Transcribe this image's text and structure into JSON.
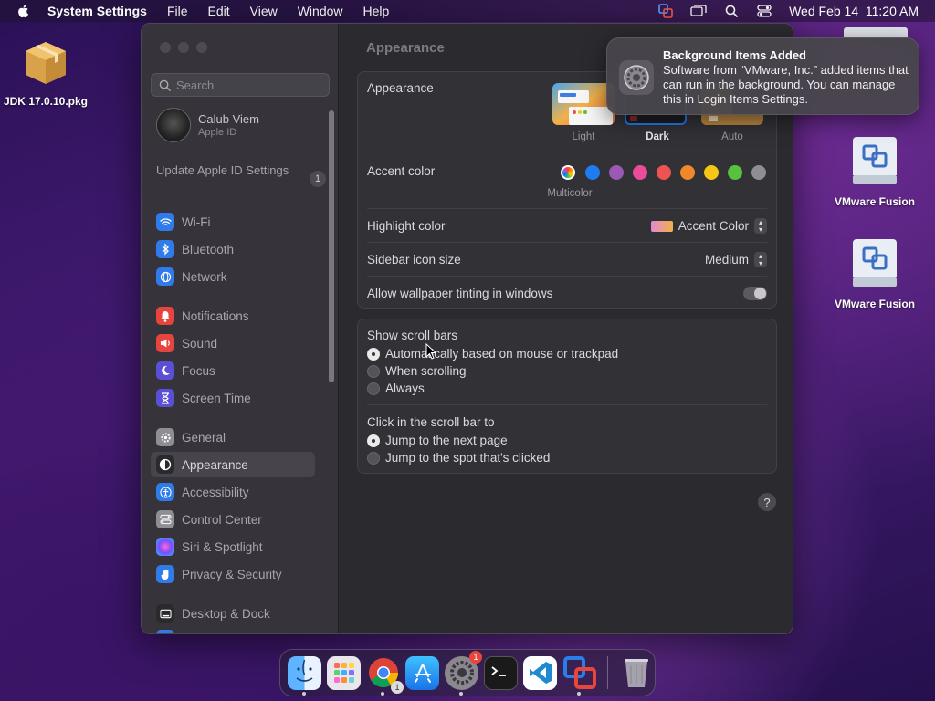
{
  "menubar": {
    "app_name": "System Settings",
    "menus": [
      "File",
      "Edit",
      "View",
      "Window",
      "Help"
    ],
    "datetime": "Wed Feb 14  11:20 AM"
  },
  "desktop": {
    "items": [
      {
        "label": "JDK 17.0.10.pkg",
        "icon": "package-icon"
      },
      {
        "label": "VMware Fusion",
        "icon": "disk-image-icon"
      },
      {
        "label": "VMware Fusion",
        "icon": "disk-image-icon"
      }
    ]
  },
  "sidebar": {
    "search_placeholder": "Search",
    "profile": {
      "name": "Calub Viem",
      "subtitle": "Apple ID"
    },
    "update": {
      "label": "Update Apple ID Settings",
      "badge": "1"
    },
    "items": [
      {
        "label": "Wi-Fi",
        "icon": "wifi-icon",
        "color": "#2f7bea"
      },
      {
        "label": "Bluetooth",
        "icon": "bluetooth-icon",
        "color": "#2f7bea"
      },
      {
        "label": "Network",
        "icon": "globe-icon",
        "color": "#2f7bea"
      },
      {
        "label": "Notifications",
        "icon": "bell-icon",
        "color": "#e6453d"
      },
      {
        "label": "Sound",
        "icon": "speaker-icon",
        "color": "#e6453d"
      },
      {
        "label": "Focus",
        "icon": "moon-icon",
        "color": "#5b4fd6"
      },
      {
        "label": "Screen Time",
        "icon": "hourglass-icon",
        "color": "#5b4fd6"
      },
      {
        "label": "General",
        "icon": "gear-icon",
        "color": "#8e8e93"
      },
      {
        "label": "Appearance",
        "icon": "appearance-icon",
        "color": "#3a3a3c"
      },
      {
        "label": "Accessibility",
        "icon": "accessibility-icon",
        "color": "#2f7bea"
      },
      {
        "label": "Control Center",
        "icon": "control-center-icon",
        "color": "#8e8e93"
      },
      {
        "label": "Siri & Spotlight",
        "icon": "siri-icon",
        "color": "#c34fd6"
      },
      {
        "label": "Privacy & Security",
        "icon": "hand-icon",
        "color": "#2f7bea"
      },
      {
        "label": "Desktop & Dock",
        "icon": "dock-icon",
        "color": "#3a3a3c"
      }
    ]
  },
  "main": {
    "title": "Appearance",
    "appearance": {
      "label": "Appearance",
      "options": [
        "Light",
        "Dark",
        "Auto"
      ],
      "selected": "Dark"
    },
    "accent": {
      "label": "Accent color",
      "caption": "Multicolor",
      "colors": [
        "#e04bbd",
        "#1f7cf0",
        "#9b59b6",
        "#ea4c9a",
        "#ee5253",
        "#f0872a",
        "#f5c518",
        "#56c23d",
        "#8e8e93"
      ]
    },
    "highlight": {
      "label": "Highlight color",
      "value": "Accent Color"
    },
    "sidebar_icon_size": {
      "label": "Sidebar icon size",
      "value": "Medium"
    },
    "wallpaper_tinting": {
      "label": "Allow wallpaper tinting in windows",
      "enabled": true
    },
    "scroll_bars": {
      "label": "Show scroll bars",
      "options": [
        "Automatically based on mouse or trackpad",
        "When scrolling",
        "Always"
      ],
      "selected": 0
    },
    "click_scroll": {
      "label": "Click in the scroll bar to",
      "options": [
        "Jump to the next page",
        "Jump to the spot that's clicked"
      ],
      "selected": 0
    },
    "help": "?"
  },
  "notification": {
    "title": "Background Items Added",
    "body": "Software from “VMware, Inc.” added items that can run in the background. You can manage this in Login Items Settings."
  },
  "dock": {
    "apps": [
      "finder",
      "launchpad",
      "chrome",
      "app-store",
      "system-settings",
      "terminal",
      "vscode",
      "vmware-fusion",
      "trash"
    ],
    "chrome_badge": "1",
    "settings_badge": "1"
  }
}
